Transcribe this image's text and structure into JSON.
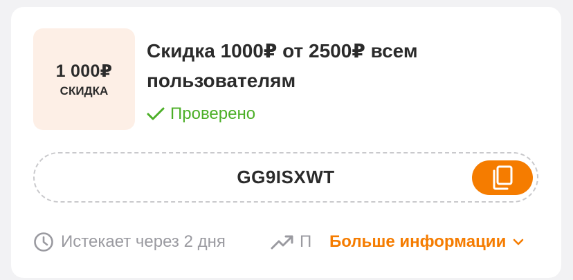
{
  "coupon": {
    "badge": {
      "amount": "1 000₽",
      "label": "СКИДКА",
      "background": "#fdefe6"
    },
    "title": "Скидка 1000₽ от 2500₽ всем пользователям",
    "verified": {
      "icon": "checkmark-icon",
      "label": "Проверено",
      "color": "#4caf27"
    },
    "code": {
      "value": "GG9ISXWT",
      "copy_icon": "copy-icon",
      "accent": "#f57c00"
    },
    "footer": {
      "expires_icon": "clock-icon",
      "expires_text": "Истекает через 2 дня",
      "trend_icon": "trending-up-icon",
      "trend_text": "П",
      "more_label": "Больше информации",
      "more_icon": "chevron-down-icon"
    }
  }
}
